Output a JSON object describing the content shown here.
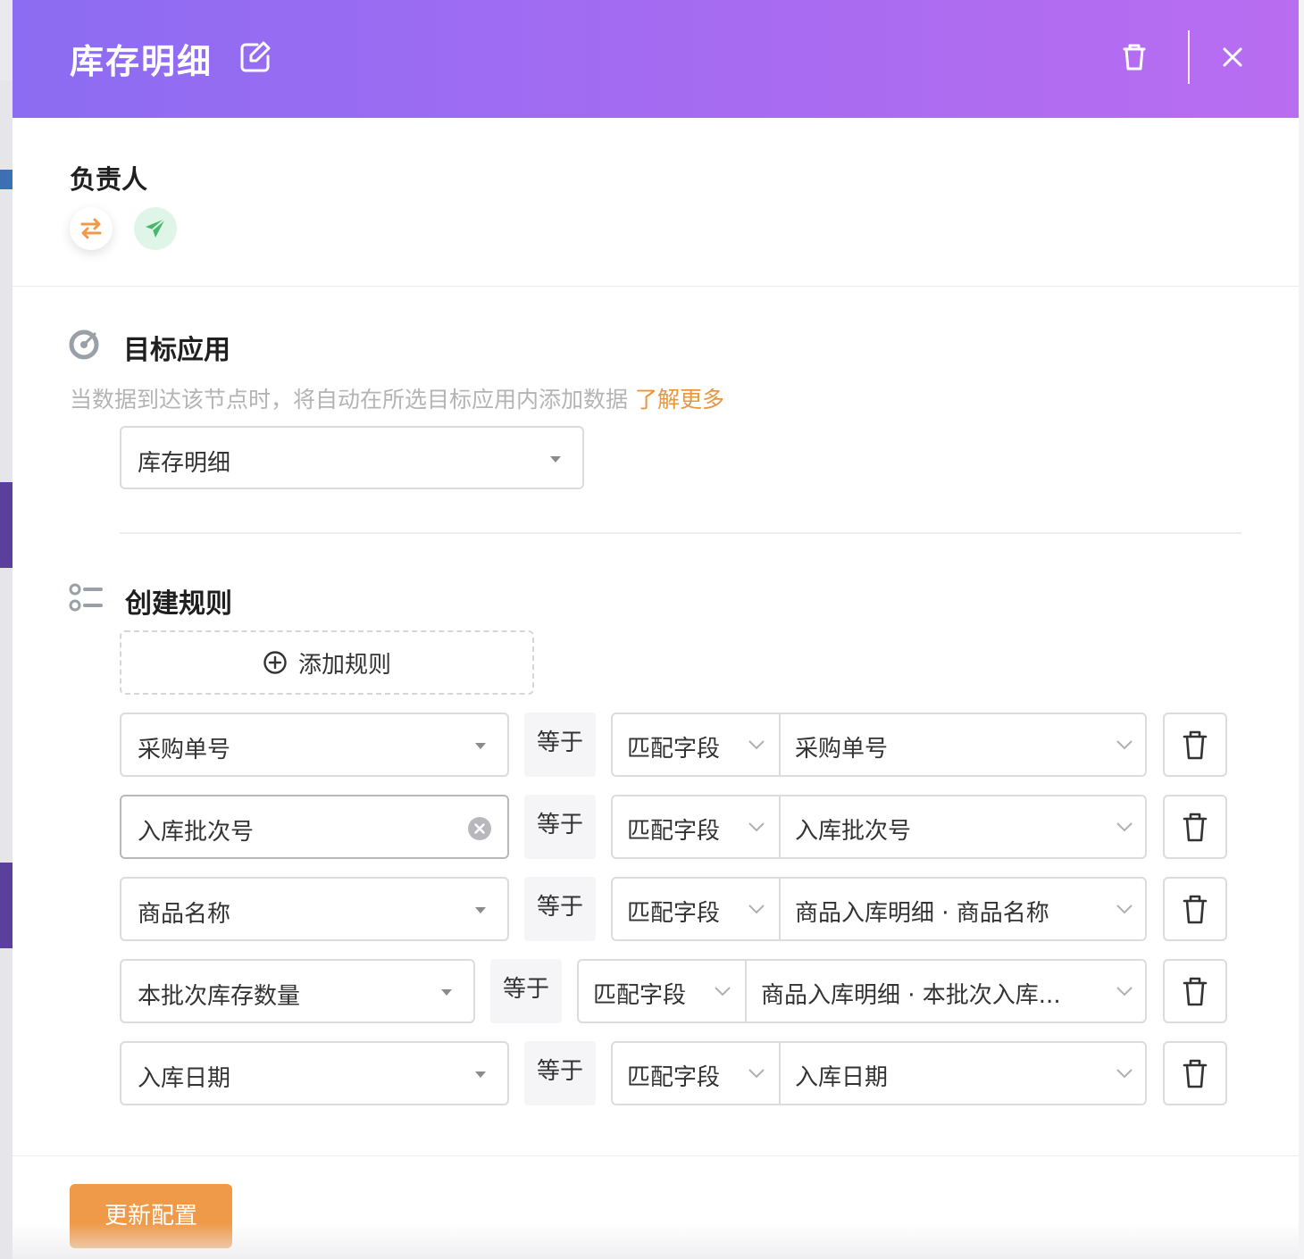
{
  "header": {
    "title": "库存明细",
    "icons": {
      "edit": "edit-icon",
      "trash": "trash-icon",
      "close": "close-icon"
    }
  },
  "owner": {
    "label": "负责人",
    "icons": [
      "swap-icon",
      "send-icon"
    ]
  },
  "target": {
    "title": "目标应用",
    "description": "当数据到达该节点时，将自动在所选目标应用内添加数据",
    "learn_more": "了解更多",
    "selected_app": "库存明细"
  },
  "rules": {
    "title": "创建规则",
    "add_label": "添加规则",
    "items": [
      {
        "field": "采购单号",
        "operator": "等于",
        "match_type": "匹配字段",
        "match_value": "采购单号"
      },
      {
        "field": "入库批次号",
        "operator": "等于",
        "match_type": "匹配字段",
        "match_value": "入库批次号"
      },
      {
        "field": "商品名称",
        "operator": "等于",
        "match_type": "匹配字段",
        "match_value": "商品入库明细 · 商品名称"
      },
      {
        "field": "本批次库存数量",
        "operator": "等于",
        "match_type": "匹配字段",
        "match_value": "商品入库明细 · 本批次入库..."
      },
      {
        "field": "入库日期",
        "operator": "等于",
        "match_type": "匹配字段",
        "match_value": "入库日期"
      }
    ]
  },
  "footer": {
    "submit_label": "更新配置"
  },
  "colors": {
    "header_gradient_start": "#8c6cf2",
    "header_gradient_end": "#b96df1",
    "accent_orange": "#ef9a48",
    "link_orange": "#e8963e",
    "send_green": "#46b86c"
  }
}
